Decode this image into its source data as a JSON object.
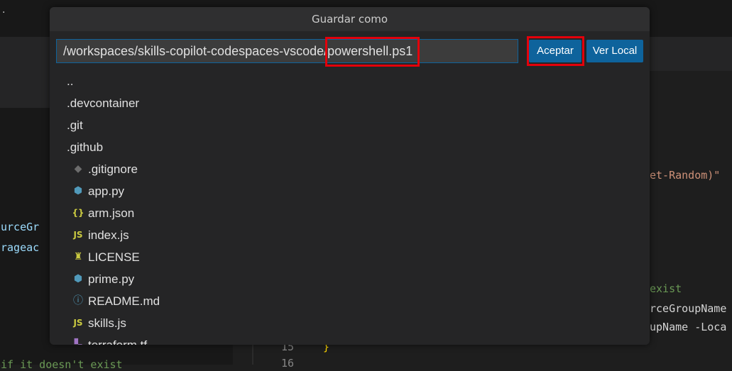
{
  "dialog": {
    "title": "Guardar como",
    "path_value": "/workspaces/skills-copilot-codespaces-vscode/powershell.ps1",
    "accept_label": "Aceptar",
    "local_label": "Ver Local"
  },
  "files": [
    {
      "name": "..",
      "icon": ""
    },
    {
      "name": ".devcontainer",
      "icon": ""
    },
    {
      "name": ".git",
      "icon": ""
    },
    {
      "name": ".github",
      "icon": ""
    },
    {
      "name": ".gitignore",
      "icon": "git-diamond-icon",
      "glyph": "◆",
      "color": "#6d6d6d"
    },
    {
      "name": "app.py",
      "icon": "python-icon",
      "glyph": "⬢",
      "color": "#519aba"
    },
    {
      "name": "arm.json",
      "icon": "json-braces-icon",
      "glyph": "{}",
      "color": "#cbcb41"
    },
    {
      "name": "index.js",
      "icon": "javascript-icon",
      "glyph": "JS",
      "color": "#cbcb41"
    },
    {
      "name": "LICENSE",
      "icon": "license-icon",
      "glyph": "♜",
      "color": "#cbcb41"
    },
    {
      "name": "prime.py",
      "icon": "python-icon",
      "glyph": "⬢",
      "color": "#519aba"
    },
    {
      "name": "README.md",
      "icon": "info-icon",
      "glyph": "ⓘ",
      "color": "#519aba"
    },
    {
      "name": "skills.js",
      "icon": "javascript-icon",
      "glyph": "JS",
      "color": "#cbcb41"
    },
    {
      "name": "terraform.tf",
      "icon": "terraform-icon",
      "glyph": "▚",
      "color": "#a074c4"
    }
  ],
  "editor_fragments": {
    "left1": "urceGr",
    "left2": "rageac",
    "left3": "if it doesn't exist",
    "right1": "et-Random)\"",
    "right2": "exist",
    "right3": "rceGroupName",
    "right4": "upName -Loca",
    "ln15": "15",
    "ln16": "16",
    "brace": "}"
  },
  "colors": {
    "accent": "#0e639c",
    "highlight": "#e3000b"
  }
}
